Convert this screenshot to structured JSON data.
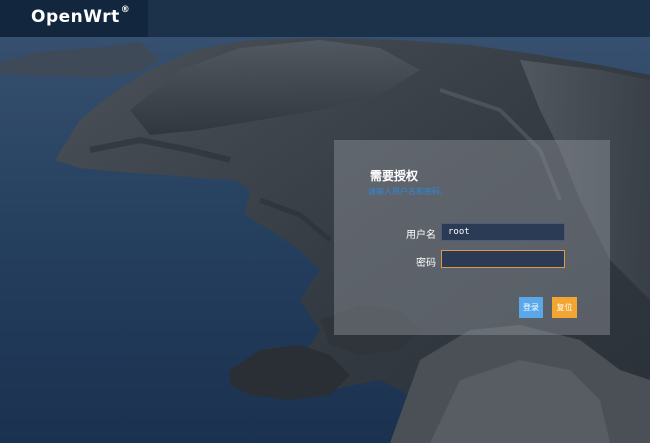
{
  "header": {
    "brand": "OpenWrt",
    "brand_mark": "®"
  },
  "login": {
    "title": "需要授权",
    "subtitle": "请输入用户名和密码。",
    "username_label": "用户名",
    "username_value": "root",
    "password_label": "密码",
    "password_value": "",
    "login_button": "登录",
    "reset_button": "复位"
  },
  "colors": {
    "header_bg": "#1a2f47",
    "subtitle_text": "#2f86d6",
    "login_button": "#5aa8ea",
    "reset_button": "#f2a531",
    "password_focus_border": "#e0954a"
  }
}
